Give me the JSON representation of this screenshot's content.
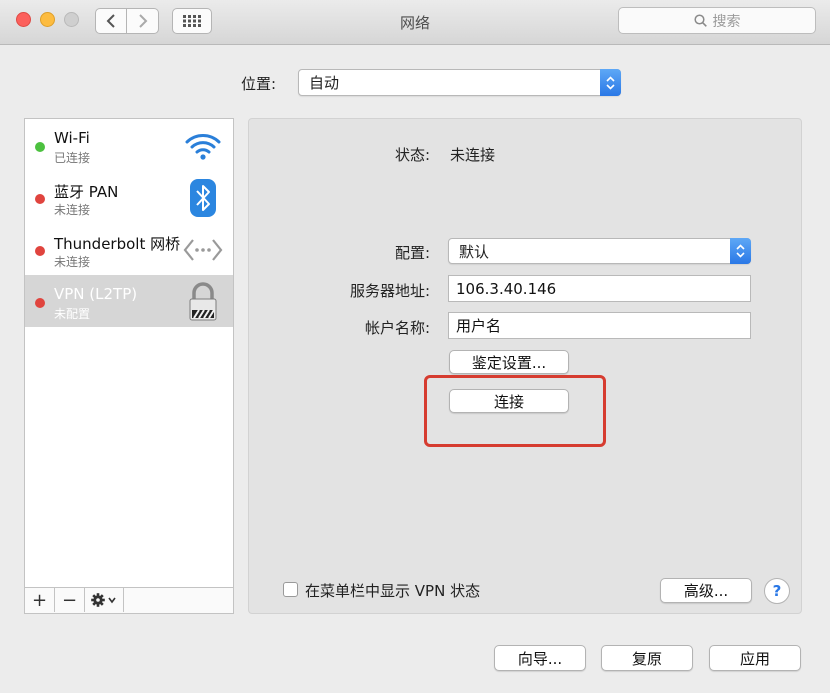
{
  "window": {
    "title": "网络"
  },
  "search": {
    "placeholder": "搜索"
  },
  "location": {
    "label": "位置:",
    "value": "自动"
  },
  "services": [
    {
      "name": "Wi-Fi",
      "status": "已连接",
      "status_color": "#4cc13f",
      "icon": "wifi-icon"
    },
    {
      "name": "蓝牙 PAN",
      "status": "未连接",
      "status_color": "#e0443e",
      "icon": "bluetooth-icon"
    },
    {
      "name": "Thunderbolt 网桥",
      "status": "未连接",
      "status_color": "#e0443e",
      "icon": "thunderbolt-bridge-icon"
    },
    {
      "name": "VPN (L2TP)",
      "status": "未配置",
      "status_color": "#e0443e",
      "icon": "lock-icon",
      "selected": true
    }
  ],
  "sidebar_tools": {
    "add": "+",
    "remove": "−",
    "gear": "gear-icon"
  },
  "detail": {
    "status_label": "状态:",
    "status_value": "未连接",
    "config_label": "配置:",
    "config_value": "默认",
    "server_label": "服务器地址:",
    "server_value": "106.3.40.146",
    "account_label": "帐户名称:",
    "account_value": "用户名",
    "auth_button": "鉴定设置...",
    "connect_button": "连接",
    "show_vpn_checkbox": "在菜单栏中显示 VPN 状态",
    "show_vpn_checked": false,
    "advanced_button": "高级...",
    "help": "?"
  },
  "footer": {
    "assistant": "向导...",
    "revert": "复原",
    "apply": "应用"
  },
  "colors": {
    "accent": "#2a78e6",
    "highlight": "#d63c30"
  }
}
